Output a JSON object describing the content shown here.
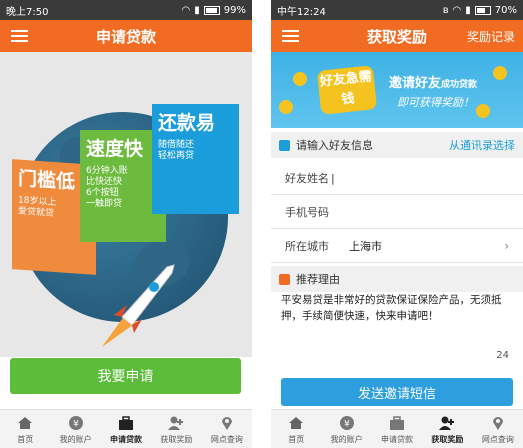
{
  "left": {
    "status": {
      "time": "晚上7:50",
      "battery": "99%"
    },
    "appbar": {
      "title": "申请贷款"
    },
    "cards": {
      "a": {
        "title": "门槛低",
        "sub": "18岁以上\n爱贷就贷"
      },
      "b": {
        "title": "速度快",
        "sub": "6分钟入账\n比快还快\n6个按钮\n一触即贷"
      },
      "c": {
        "title": "还款易",
        "sub": "随借随还\n轻松再贷"
      }
    },
    "apply_button": "我要申请",
    "tabs": [
      {
        "label": "首页",
        "icon": "home-icon"
      },
      {
        "label": "我的账户",
        "icon": "yen-icon"
      },
      {
        "label": "申请贷款",
        "icon": "briefcase-icon"
      },
      {
        "label": "获取奖励",
        "icon": "add-user-icon"
      },
      {
        "label": "网点查询",
        "icon": "location-icon"
      }
    ],
    "active_tab": 2
  },
  "right": {
    "status": {
      "time": "中午12:24",
      "battery": "70%"
    },
    "appbar": {
      "title": "获取奖励",
      "right_link": "奖励记录"
    },
    "banner": {
      "badge": "好友急需钱",
      "line1": "邀请好友",
      "line1_small": "成功贷款",
      "line2": "即可获得奖励！"
    },
    "friend_section": {
      "title": "请输入好友信息",
      "link": "从通讯录选择"
    },
    "fields": {
      "name_label": "好友姓名",
      "phone_label": "手机号码",
      "city_label": "所在城市",
      "city_value": "上海市"
    },
    "reason_section": {
      "title": "推荐理由"
    },
    "reason_text": "平安易贷是非常好的贷款保证保险产品，无须抵押，手续简便快速，快来申请吧！",
    "reason_count": "24",
    "send_button": "发送邀请短信",
    "tabs": [
      {
        "label": "首页",
        "icon": "home-icon"
      },
      {
        "label": "我的账户",
        "icon": "yen-icon"
      },
      {
        "label": "申请贷款",
        "icon": "briefcase-icon"
      },
      {
        "label": "获取奖励",
        "icon": "add-user-icon"
      },
      {
        "label": "网点查询",
        "icon": "location-icon"
      }
    ],
    "active_tab": 3
  },
  "colors": {
    "primary": "#f26b22",
    "green": "#5bbd3a",
    "blue": "#2d9fde"
  }
}
